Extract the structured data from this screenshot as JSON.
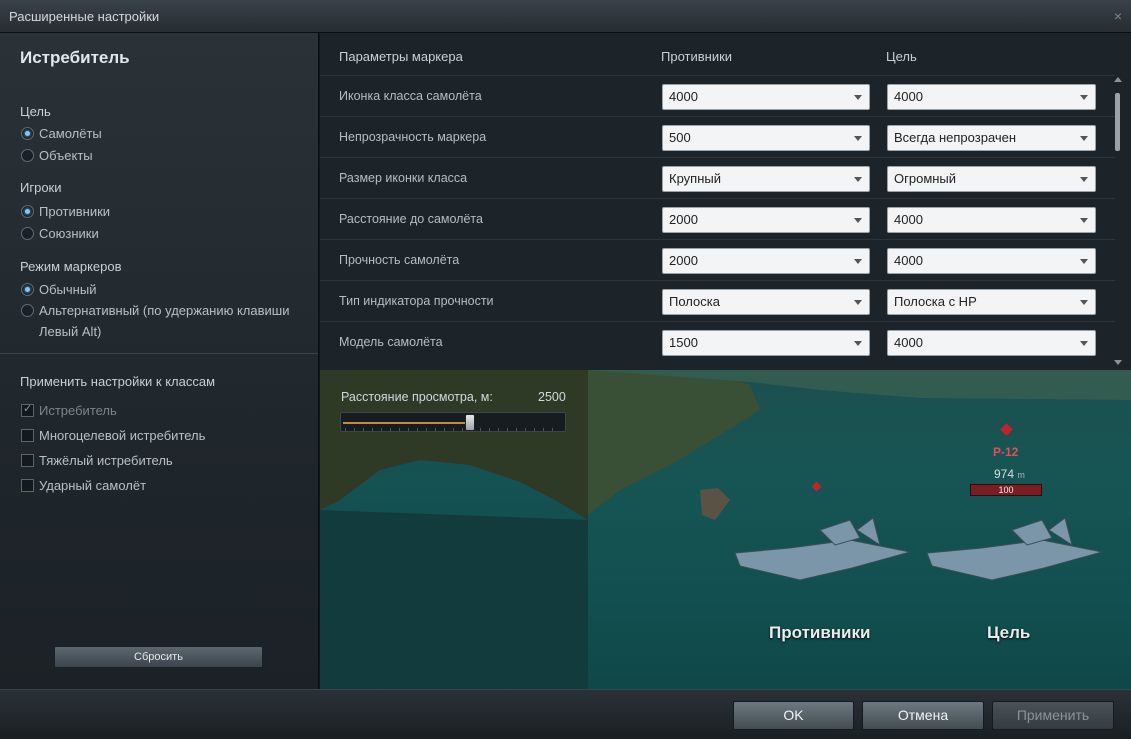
{
  "window": {
    "title": "Расширенные настройки",
    "close_glyph": "×"
  },
  "left": {
    "heading": "Истребитель",
    "target": {
      "label": "Цель",
      "options": [
        "Самолёты",
        "Объекты"
      ],
      "selected": 0
    },
    "players": {
      "label": "Игроки",
      "options": [
        "Противники",
        "Союзники"
      ],
      "selected": 0
    },
    "marker_mode": {
      "label": "Режим маркеров",
      "options": [
        "Обычный",
        "Альтернативный (по удержанию клавиши",
        "Левый Alt)"
      ],
      "selected": 0
    },
    "apply_classes": {
      "label": "Применить настройки к классам",
      "items": [
        {
          "label": "Истребитель",
          "checked": true,
          "disabled": true
        },
        {
          "label": "Многоцелевой истребитель",
          "checked": false
        },
        {
          "label": "Тяжёлый истребитель",
          "checked": false
        },
        {
          "label": "Ударный самолёт",
          "checked": false
        }
      ]
    },
    "reset_label": "Сбросить"
  },
  "table": {
    "headers": [
      "Параметры маркера",
      "Противники",
      "Цель"
    ],
    "rows": [
      {
        "label": "Иконка класса самолёта",
        "enemies": "4000",
        "target": "4000"
      },
      {
        "label": "Непрозрачность маркера",
        "enemies": "500",
        "target": "Всегда непрозрачен"
      },
      {
        "label": "Размер иконки класса",
        "enemies": "Крупный",
        "target": "Огромный"
      },
      {
        "label": "Расстояние до самолёта",
        "enemies": "2000",
        "target": "4000"
      },
      {
        "label": "Прочность самолёта",
        "enemies": "2000",
        "target": "4000"
      },
      {
        "label": "Тип индикатора прочности",
        "enemies": "Полоска",
        "target": "Полоска с HP"
      },
      {
        "label": "Модель самолёта",
        "enemies": "1500",
        "target": "4000"
      }
    ]
  },
  "preview": {
    "slider_label": "Расстояние просмотра, м:",
    "slider_value": "2500",
    "slider_fraction": 0.58,
    "target_plane": {
      "name": "P-12",
      "distance": "974",
      "unit": "m",
      "hp": "100"
    },
    "label_enemies": "Противники",
    "label_target": "Цель"
  },
  "footer": {
    "ok": "OK",
    "cancel": "Отмена",
    "apply": "Применить"
  },
  "colors": {
    "accent": "#7fc6ff",
    "marker_red": "#c0232c"
  }
}
